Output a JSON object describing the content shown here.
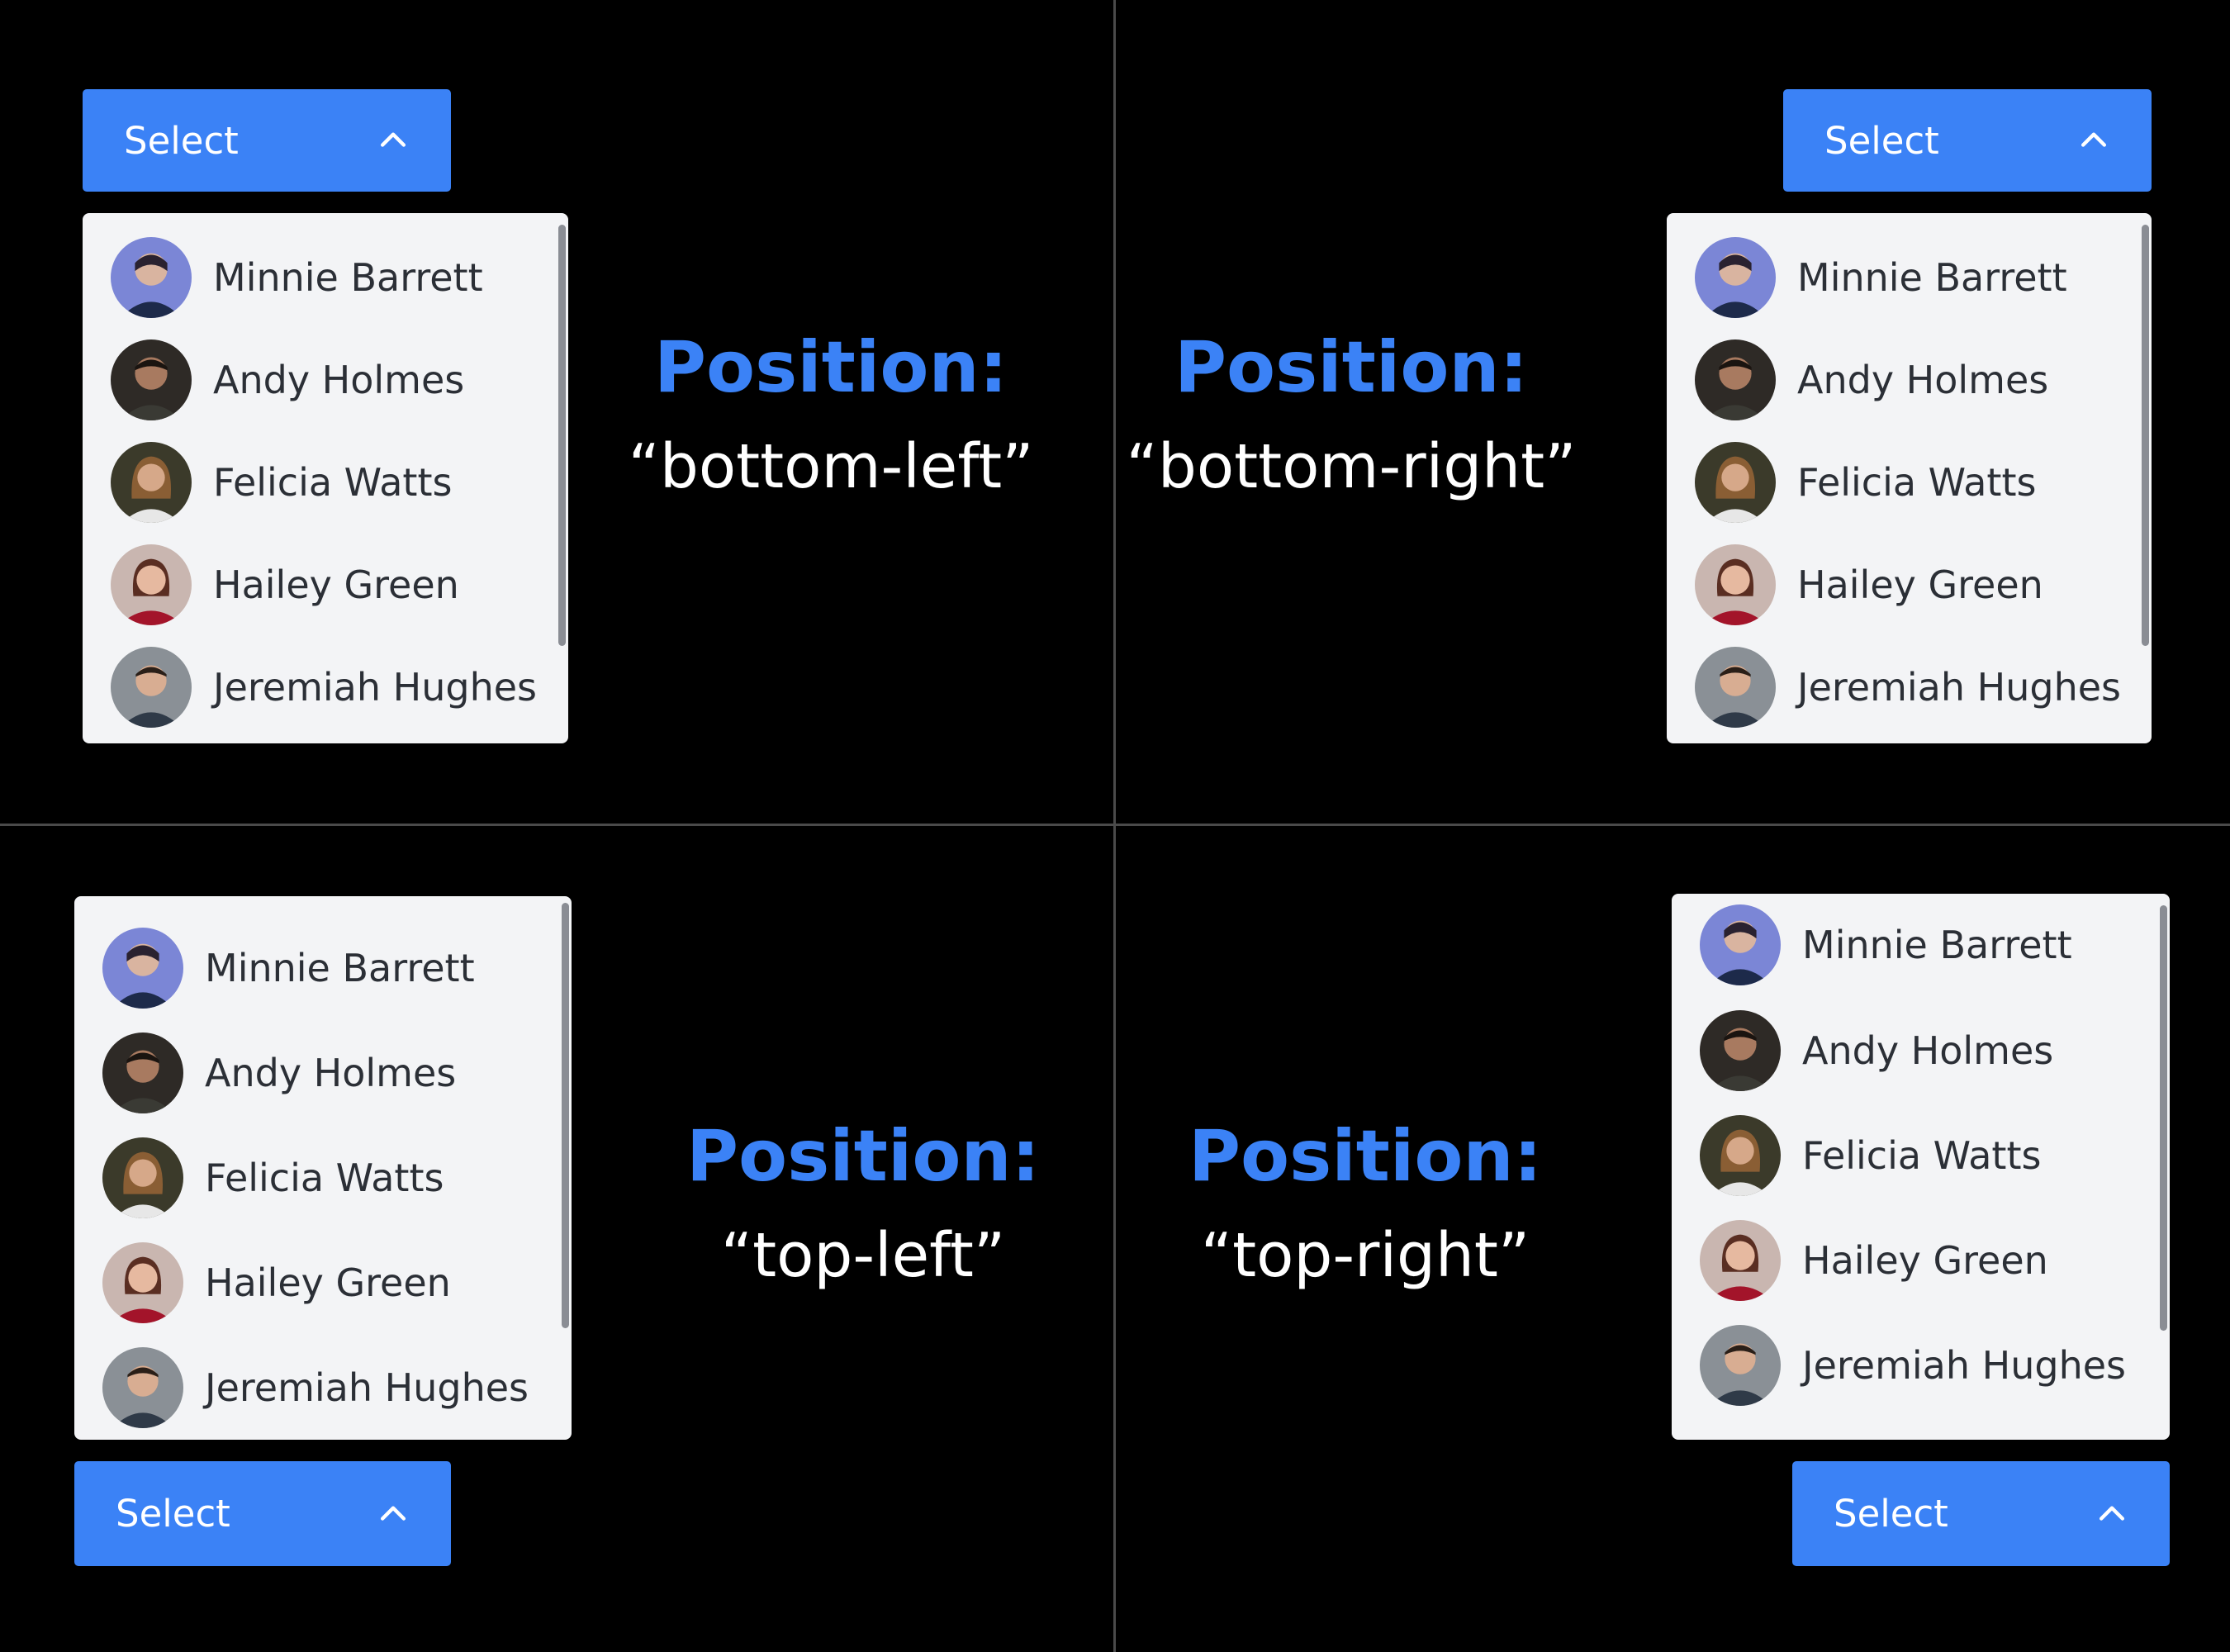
{
  "colors": {
    "background": "#000000",
    "accent": "#3b82f6",
    "dropdown_bg": "#f3f4f6",
    "divider": "#4a4a4a"
  },
  "select": {
    "label": "Select",
    "icon": "chevron-up-icon"
  },
  "options": [
    {
      "name": "Minnie Barrett",
      "avatar": "avatar-minnie"
    },
    {
      "name": "Andy Holmes",
      "avatar": "avatar-andy"
    },
    {
      "name": "Felicia Watts",
      "avatar": "avatar-felicia"
    },
    {
      "name": "Hailey Green",
      "avatar": "avatar-hailey"
    },
    {
      "name": "Jeremiah Hughes",
      "avatar": "avatar-jeremiah"
    }
  ],
  "quadrants": [
    {
      "key": "bottom-left",
      "title": "Position:",
      "value": "“bottom-left”"
    },
    {
      "key": "bottom-right",
      "title": "Position:",
      "value": "“bottom-right”"
    },
    {
      "key": "top-left",
      "title": "Position:",
      "value": "“top-left”"
    },
    {
      "key": "top-right",
      "title": "Position:",
      "value": "“top-right”"
    }
  ]
}
